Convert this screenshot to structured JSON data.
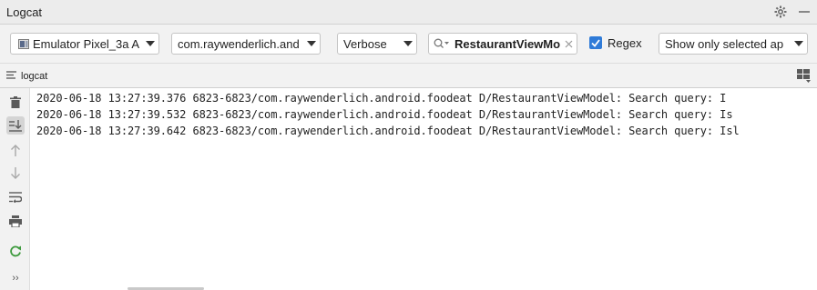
{
  "window": {
    "title": "Logcat"
  },
  "toolbar": {
    "device": "Emulator Pixel_3a A",
    "process": "com.raywenderlich.and",
    "log_level": "Verbose",
    "search_value": "RestaurantViewMo",
    "regex_label": "Regex",
    "regex_checked": true,
    "filter": "Show only selected ap"
  },
  "tab": {
    "label": "logcat"
  },
  "log": {
    "lines": [
      "2020-06-18 13:27:39.376 6823-6823/com.raywenderlich.android.foodeat D/RestaurantViewModel: Search query: I",
      "2020-06-18 13:27:39.532 6823-6823/com.raywenderlich.android.foodeat D/RestaurantViewModel: Search query: Is",
      "2020-06-18 13:27:39.642 6823-6823/com.raywenderlich.android.foodeat D/RestaurantViewModel: Search query: Isl"
    ]
  },
  "sidebar": {
    "more_label": "››"
  },
  "colors": {
    "accent": "#2f7bd8",
    "rerun": "#3d9a3d"
  },
  "icons": [
    "gear-icon",
    "minimize-icon",
    "device-icon",
    "chevron-down-icon",
    "search-icon",
    "clear-icon",
    "checkbox-checked-icon",
    "logcat-tab-icon",
    "layout-icon",
    "trash-icon",
    "scroll-to-end-icon",
    "up-arrow-icon",
    "down-arrow-icon",
    "soft-wrap-icon",
    "print-icon",
    "restart-icon"
  ]
}
